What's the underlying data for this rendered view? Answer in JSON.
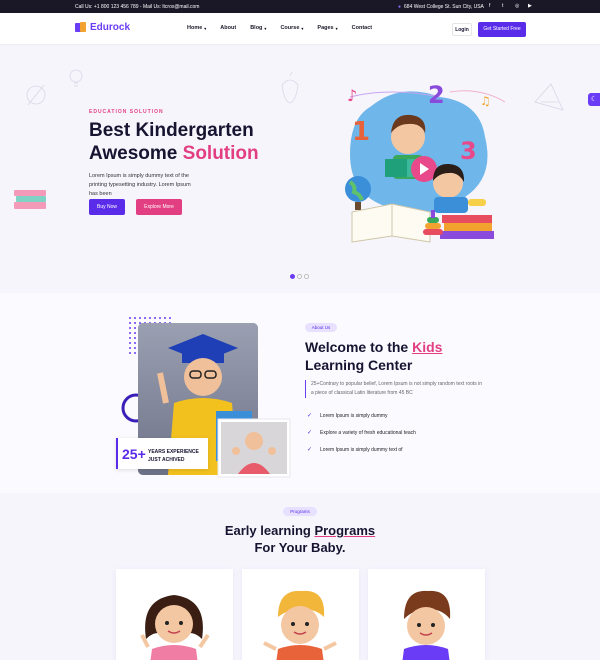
{
  "topbar": {
    "contact": "Call Us: +1 800 123 456 789 - Mail Us: ltcrox@mail.com",
    "address": "684 West College St. Sun City, USA",
    "socials": [
      "facebook-icon",
      "twitter-icon",
      "instagram-icon",
      "youtube-icon"
    ]
  },
  "nav": {
    "brand": "Edurock",
    "items": [
      {
        "label": "Home",
        "has_dropdown": true
      },
      {
        "label": "About",
        "has_dropdown": false
      },
      {
        "label": "Blog",
        "has_dropdown": true
      },
      {
        "label": "Course",
        "has_dropdown": true
      },
      {
        "label": "Pages",
        "has_dropdown": true
      },
      {
        "label": "Contact",
        "has_dropdown": false
      }
    ],
    "login": "Login",
    "cta": "Get Started Free"
  },
  "hero": {
    "kicker": "EDUCATION SOLUTION",
    "title_line1": "Best Kindergarten",
    "title_line2_plain": "Awesome ",
    "title_line2_accent": "Solution",
    "description": "Lorem Ipsum is simply dummy text of the printing typesetting industry. Lorem Ipsum has been",
    "buy_button": "Buy Now",
    "explore_button": "Explore More",
    "slides": 3,
    "active_slide": 1
  },
  "about": {
    "badge": "About Us",
    "title_prefix": "Welcome to the ",
    "title_highlight": "Kids",
    "title_line2": "Learning Center",
    "description": "25+Contrary to popular belief, Lorem Ipsum is not simply random text roots in a piece of classical Latin literature from 45 BC",
    "checks": [
      "Lorem Ipsum is simply dummy",
      "Explore a variety of fresh educational teach",
      "Lorem Ipsum is simply dummy text of"
    ],
    "experience_number": "25+",
    "experience_line1": "YEARS EXPERIENCE",
    "experience_line2": "JUST ACHIVED"
  },
  "programs": {
    "badge": "Programs",
    "title_prefix": "Early learning ",
    "title_highlight": "Programs",
    "title_line2": "For Your Baby."
  },
  "colors": {
    "primary": "#5b2bea",
    "accent": "#e23f83",
    "dark": "#1a1727"
  }
}
